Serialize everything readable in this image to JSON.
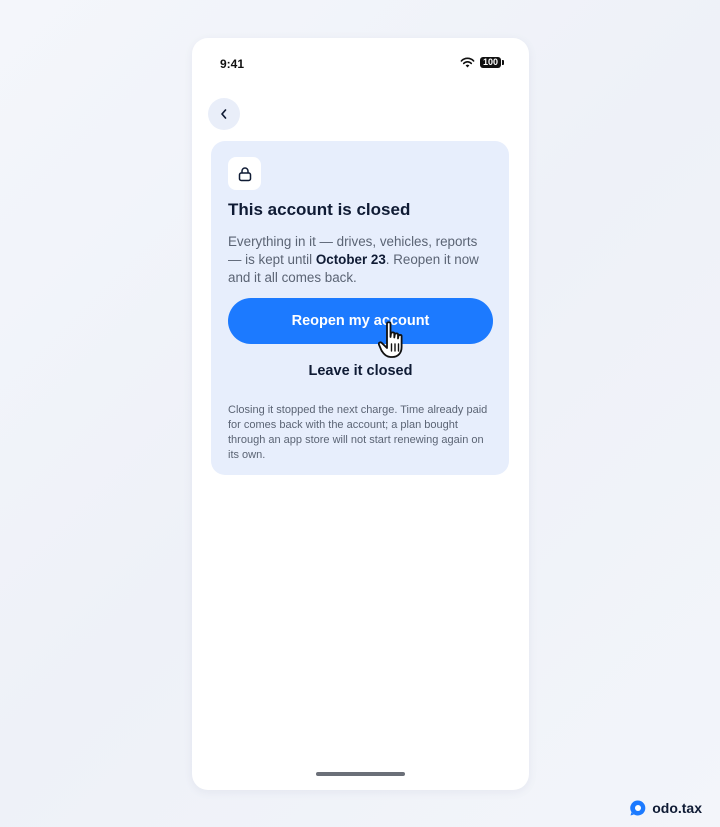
{
  "status_bar": {
    "time": "9:41",
    "battery": "100",
    "icons": [
      "wifi-icon",
      "battery-icon"
    ]
  },
  "back_button": {
    "icon": "chevron-left-icon"
  },
  "card": {
    "icon": "lock-icon",
    "title": "This account is closed",
    "body_prefix": "Everything in it — drives, vehicles, reports — is kept until ",
    "body_date": "October 23",
    "body_suffix": ". Reopen it now and it all comes back.",
    "primary_label": "Reopen my account",
    "secondary_label": "Leave it closed",
    "footnote": "Closing it stopped the next charge. Time already paid for comes back with the account; a plan bought through an app store will not start renewing again on its own."
  },
  "brand": {
    "name": "odo.tax"
  },
  "colors": {
    "accent": "#1c7aff",
    "card_bg": "#e7eefc",
    "text_dark": "#0f1b34",
    "text_muted": "#5b6474"
  }
}
